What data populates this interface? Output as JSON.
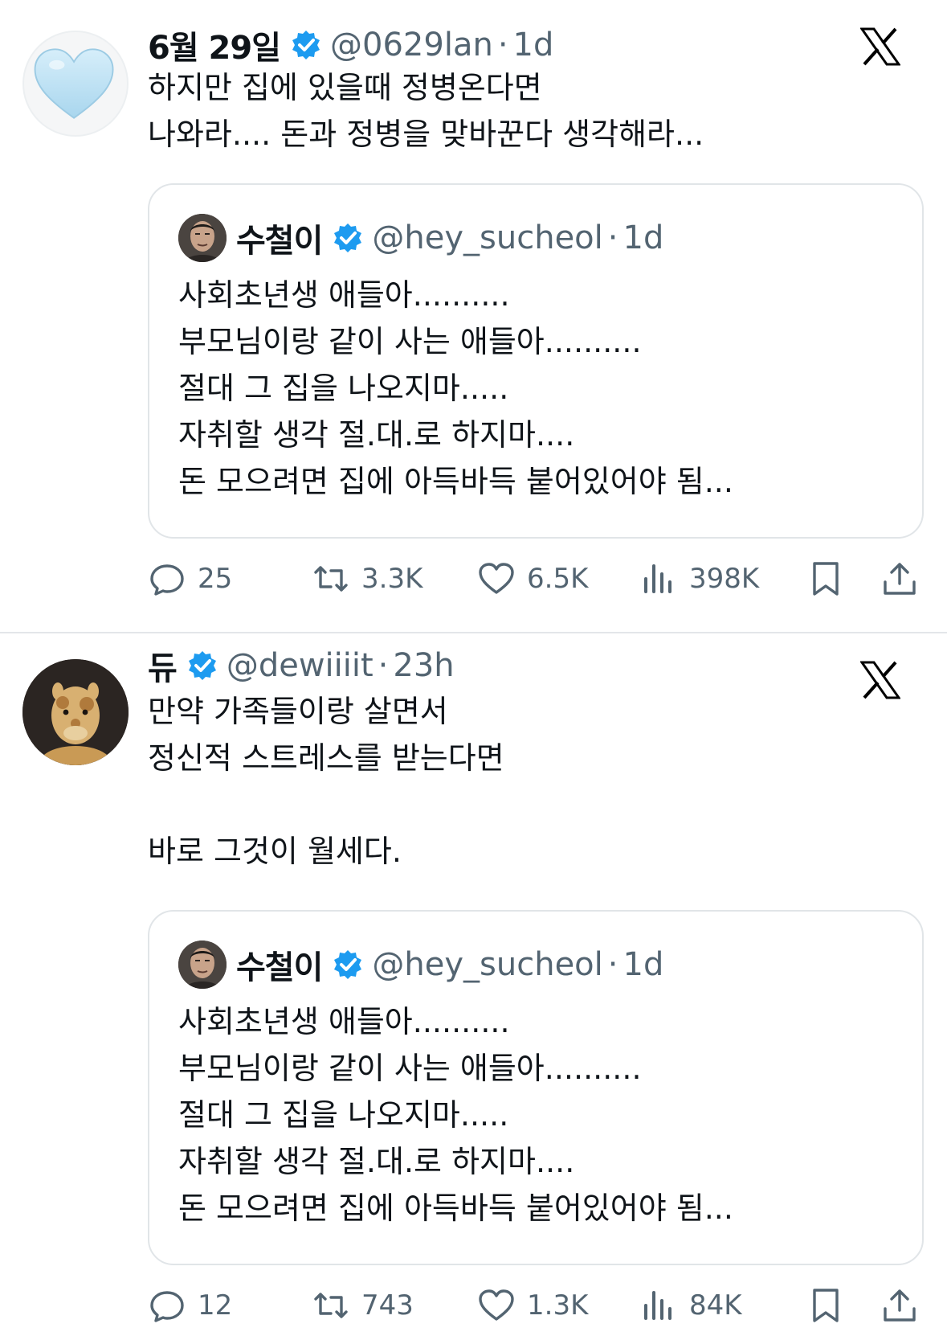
{
  "tweets": [
    {
      "name": "6월 29일",
      "handle": "@0629lan",
      "dot": "·",
      "time": "1d",
      "text": "하지만 집에 있을때 정병온다면\n나와라.... 돈과 정병을 맞바꾼다 생각해라...",
      "quote": {
        "name": "수철이",
        "handle": "@hey_sucheol",
        "dot": "·",
        "time": "1d",
        "text": "사회초년생 애들아..........\n부모님이랑 같이 사는 애들아..........\n절대 그 집을 나오지마.....\n자취할 생각 절.대.로 하지마....\n돈 모으려면 집에 아득바득 붙어있어야 됨..."
      },
      "stats": {
        "replies": "25",
        "retweets": "3.3K",
        "likes": "6.5K",
        "views": "398K"
      }
    },
    {
      "name": "듀",
      "handle": "@dewiiiit",
      "dot": "·",
      "time": "23h",
      "text": "만약 가족들이랑 살면서\n정신적 스트레스를 받는다면\n\n바로 그것이 월세다.",
      "quote": {
        "name": "수철이",
        "handle": "@hey_sucheol",
        "dot": "·",
        "time": "1d",
        "text": "사회초년생 애들아..........\n부모님이랑 같이 사는 애들아..........\n절대 그 집을 나오지마.....\n자취할 생각 절.대.로 하지마....\n돈 모으려면 집에 아득바득 붙어있어야 됨..."
      },
      "stats": {
        "replies": "12",
        "retweets": "743",
        "likes": "1.3K",
        "views": "84K"
      }
    }
  ],
  "icons": [
    "light-blue-heart-icon",
    "giraffe-plush-avatar",
    "verified-badge-icon",
    "x-logo-icon",
    "reply-icon",
    "retweet-icon",
    "like-icon",
    "views-icon",
    "bookmark-icon",
    "share-icon"
  ],
  "colors": {
    "verified": "#1d9bf0",
    "muted": "#536471",
    "border": "#e1e5e8",
    "heart": "#bfe2f3"
  }
}
